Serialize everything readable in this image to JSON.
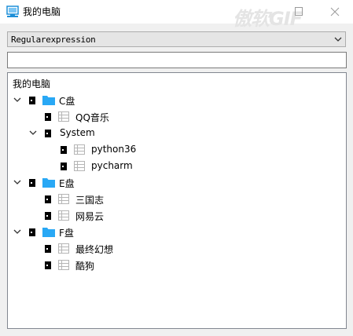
{
  "window": {
    "title": "我的电脑",
    "watermark": "傲软GIF",
    "minimize_icon": "minimize-icon",
    "close_icon": "close-icon"
  },
  "combo": {
    "value": "Regularexpression",
    "arrow_icon": "chevron-down-icon"
  },
  "filter_input": {
    "value": ""
  },
  "tree": {
    "header": "我的电脑",
    "nodes": [
      {
        "label": "C盘",
        "icon": "folder-icon",
        "expanded": true
      },
      {
        "label": "QQ音乐",
        "icon": "file-table-icon"
      },
      {
        "label": "System",
        "icon": "none",
        "expanded": true
      },
      {
        "label": "python36",
        "icon": "file-table-icon"
      },
      {
        "label": "pycharm",
        "icon": "file-table-icon"
      },
      {
        "label": "E盘",
        "icon": "folder-icon",
        "expanded": true
      },
      {
        "label": "三国志",
        "icon": "file-table-icon"
      },
      {
        "label": "网易云",
        "icon": "file-table-icon"
      },
      {
        "label": "F盘",
        "icon": "folder-icon",
        "expanded": true
      },
      {
        "label": "最终幻想",
        "icon": "file-table-icon"
      },
      {
        "label": "酷狗",
        "icon": "file-table-icon"
      }
    ]
  },
  "colors": {
    "folder": "#29a8f5",
    "accent": "#1e8fd8",
    "lock": "#000000"
  }
}
